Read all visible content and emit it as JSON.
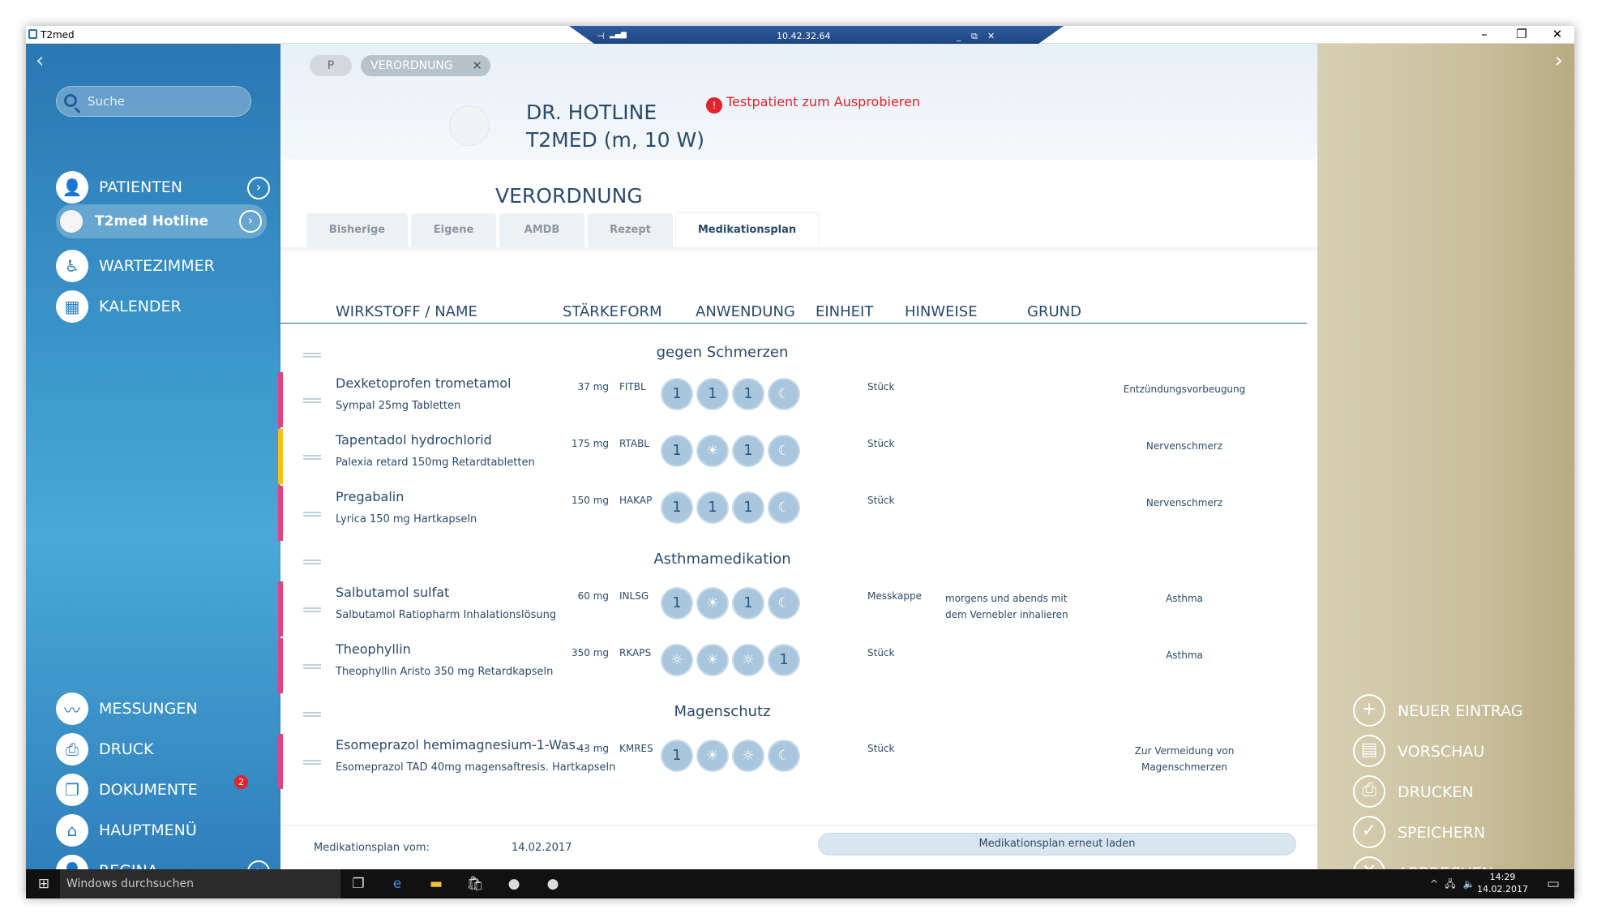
{
  "window": {
    "title": "T2med",
    "minimize": "–",
    "maximize": "❐",
    "close": "✕"
  },
  "rdp": {
    "pin": "⊣",
    "signal": "▂▄▆",
    "ip": "10.42.32.64",
    "min": "_",
    "restore": "⧉",
    "close": "✕"
  },
  "sidebar": {
    "search_placeholder": "Suche",
    "top": [
      {
        "label": "PATIENTEN",
        "icon": "person-icon"
      },
      {
        "label": "T2med Hotline",
        "icon": "avatar-icon"
      },
      {
        "label": "WARTEZIMMER",
        "icon": "waiting-room-icon"
      },
      {
        "label": "KALENDER",
        "icon": "calendar-icon"
      }
    ],
    "bottom": [
      {
        "label": "MESSUNGEN",
        "icon": "pulse-icon"
      },
      {
        "label": "DRUCK",
        "icon": "printer-icon"
      },
      {
        "label": "DOKUMENTE",
        "icon": "documents-icon",
        "badge": "2"
      },
      {
        "label": "HAUPTMENÜ",
        "icon": "home-icon"
      },
      {
        "label": "REGINA",
        "icon": "person-icon"
      }
    ]
  },
  "header": {
    "chip_p": "P",
    "chip_tab": "VERORDNUNG",
    "patient_line1": "DR. HOTLINE",
    "patient_line2": "T2MED (m, 10 W)",
    "warning": "Testpatient zum Ausprobieren"
  },
  "panel": {
    "title": "VERORDNUNG",
    "tabs": [
      "Bisherige",
      "Eigene",
      "AMDB",
      "Rezept",
      "Medikationsplan"
    ],
    "active_tab": "Medikationsplan"
  },
  "columns": {
    "name": "WIRKSTOFF / NAME",
    "strength": "STÄRKE",
    "form": "FORM",
    "usage": "ANWENDUNG",
    "unit": "EINHEIT",
    "notes": "HINWEISE",
    "reason": "GRUND"
  },
  "groups": [
    "gegen Schmerzen",
    "Asthmamedikation",
    "Magenschutz"
  ],
  "rows": [
    {
      "name": "Dexketoprofen trometamol",
      "product": "Sympal 25mg Tabletten",
      "strength": "37 mg",
      "form": "FITBL",
      "doses": [
        "1",
        "1",
        "1",
        "☾"
      ],
      "unit": "Stück",
      "notes": "",
      "reason": "Entzündungsvorbeugung",
      "color": "#e0457b"
    },
    {
      "name": "Tapentadol hydrochlorid",
      "product": "Palexia retard 150mg Retardtabletten",
      "strength": "175 mg",
      "form": "RTABL",
      "doses": [
        "1",
        "☀",
        "1",
        "☾"
      ],
      "unit": "Stück",
      "notes": "",
      "reason": "Nervenschmerz",
      "color": "#f2c318"
    },
    {
      "name": "Pregabalin",
      "product": "Lyrica 150 mg Hartkapseln",
      "strength": "150 mg",
      "form": "HAKAP",
      "doses": [
        "1",
        "1",
        "1",
        "☾"
      ],
      "unit": "Stück",
      "notes": "",
      "reason": "Nervenschmerz",
      "color": "#e0457b"
    },
    {
      "name": "Salbutamol sulfat",
      "product": "Salbutamol Ratiopharm Inhalationslösung",
      "strength": "60 mg",
      "form": "INLSG",
      "doses": [
        "1",
        "☀",
        "1",
        "☾"
      ],
      "unit": "Messkappe",
      "notes": "morgens und abends mit dem Vernebler inhalieren",
      "reason": "Asthma",
      "color": "#e0457b"
    },
    {
      "name": "Theophyllin",
      "product": "Theophyllin Aristo 350 mg Retardkapseln",
      "strength": "350 mg",
      "form": "RKAPS",
      "doses": [
        "☼",
        "☀",
        "☼",
        "1"
      ],
      "unit": "Stück",
      "notes": "",
      "reason": "Asthma",
      "color": "#e0457b"
    },
    {
      "name": "Esomeprazol hemimagnesium-1-Was...",
      "product": "Esomeprazol TAD 40mg magensaftresis. Hartkapseln",
      "strength": "43 mg",
      "form": "KMRES",
      "doses": [
        "1",
        "☀",
        "☼",
        "☾"
      ],
      "unit": "Stück",
      "notes": "",
      "reason": "Zur Vermeidung von Magenschmerzen",
      "color": "#e0457b"
    }
  ],
  "actions": [
    {
      "label": "NEUER EINTRAG",
      "icon": "+"
    },
    {
      "label": "VORSCHAU",
      "icon": "▤"
    },
    {
      "label": "DRUCKEN",
      "icon": "⎙"
    },
    {
      "label": "SPEICHERN",
      "icon": "✓"
    },
    {
      "label": "ABBRECHEN",
      "icon": "✕"
    }
  ],
  "footer": {
    "label": "Medikationsplan vom:",
    "date": "14.02.2017",
    "reload": "Medikationsplan erneut laden"
  },
  "taskbar": {
    "search": "Windows durchsuchen",
    "time": "14:29",
    "date": "14.02.2017"
  }
}
